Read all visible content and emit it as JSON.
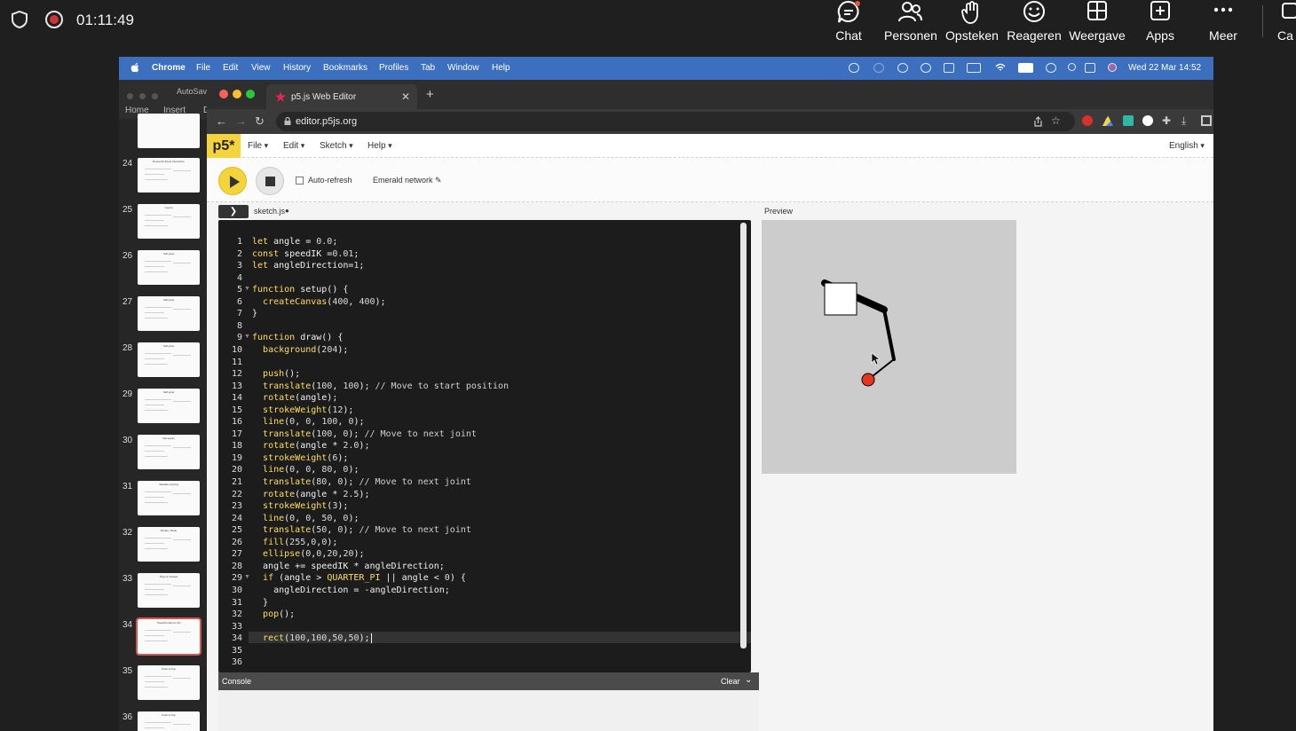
{
  "teams": {
    "timer": "01:11:49",
    "actions": [
      {
        "label": "Chat",
        "icon": "chat-icon"
      },
      {
        "label": "Personen",
        "icon": "people-icon"
      },
      {
        "label": "Opsteken",
        "icon": "raise-hand-icon"
      },
      {
        "label": "Reageren",
        "icon": "smiley-icon"
      },
      {
        "label": "Weergave",
        "icon": "grid-icon"
      },
      {
        "label": "Apps",
        "icon": "plus-box-icon"
      },
      {
        "label": "Meer",
        "icon": "more-icon"
      }
    ],
    "cut_label": "Ca"
  },
  "mac_menubar": {
    "app": "Chrome",
    "items": [
      "File",
      "Edit",
      "View",
      "History",
      "Bookmarks",
      "Profiles",
      "Tab",
      "Window",
      "Help"
    ],
    "clock": "Wed 22 Mar  14:52"
  },
  "powerpoint": {
    "autosave": "AutoSav",
    "tabs": [
      "Home",
      "Insert",
      "D"
    ],
    "slides": [
      {
        "num": "24",
        "title": "Research Excel Interactive"
      },
      {
        "num": "25",
        "title": "Layout"
      },
      {
        "num": "26",
        "title": "Self-pixel"
      },
      {
        "num": "27",
        "title": "Self-pixel"
      },
      {
        "num": "28",
        "title": "Self-pixel"
      },
      {
        "num": "29",
        "title": "Self-pixel"
      },
      {
        "num": "30",
        "title": "Gameplay"
      },
      {
        "num": "31",
        "title": "Variable scoping"
      },
      {
        "num": "32",
        "title": "Modes, Mode"
      },
      {
        "num": "33",
        "title": "Style & Tweaks"
      },
      {
        "num": "34",
        "title": "Transformations (IK)",
        "selected": true
      },
      {
        "num": "35",
        "title": "Push & Pop"
      },
      {
        "num": "36",
        "title": "Push & Pop"
      }
    ]
  },
  "chrome": {
    "tab_title": "p5.js Web Editor",
    "url": "editor.p5js.org"
  },
  "p5": {
    "logo": "p5*",
    "menus": [
      "File",
      "Edit",
      "Sketch",
      "Help"
    ],
    "language": "English",
    "auto_refresh": "Auto-refresh",
    "sketch_name": "Emerald network",
    "file_tab": "sketch.js",
    "preview_label": "Preview",
    "console_title": "Console",
    "console_clear": "Clear"
  },
  "code": [
    "let angle = 0.0;",
    "const speedIK =0.01;",
    "let angleDirection=1;",
    "",
    "function setup() {",
    "  createCanvas(400, 400);",
    "}",
    "",
    "function draw() {",
    "  background(204);",
    "",
    "  push();",
    "  translate(100, 100); // Move to start position",
    "  rotate(angle);",
    "  strokeWeight(12);",
    "  line(0, 0, 100, 0);",
    "  translate(100, 0); // Move to next joint",
    "  rotate(angle * 2.0);",
    "  strokeWeight(6);",
    "  line(0, 0, 80, 0);",
    "  translate(80, 0); // Move to next joint",
    "  rotate(angle * 2.5);",
    "  strokeWeight(3);",
    "  line(0, 0, 50, 0);",
    "  translate(50, 0); // Move to next joint",
    "  fill(255,0,0);",
    "  ellipse(0,0,20,20);",
    "  angle += speedIK * angleDirection;",
    "  if (angle > QUARTER_PI || angle < 0) {",
    "    angleDirection = -angleDirection;",
    "  }",
    "  pop();",
    "",
    "  rect(100,100,50,50);",
    "",
    ""
  ],
  "colors": {
    "teams_bg": "#1f1f1f",
    "mac_menubar": "#3c6fbd",
    "p5_yellow": "#f5d33a",
    "ellipse_red": "#e8361e",
    "canvas_bg": "#cccccc"
  }
}
